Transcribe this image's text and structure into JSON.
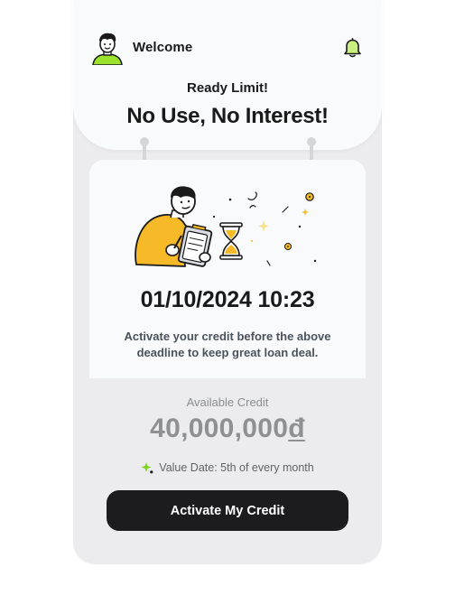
{
  "header": {
    "welcome": "Welcome",
    "subtitle": "Ready Limit!",
    "headline": "No Use, No Interest!"
  },
  "offer": {
    "deadline": "01/10/2024 10:23",
    "description": "Activate your credit before the above deadline to keep great loan deal."
  },
  "credit": {
    "label": "Available Credit",
    "amount": "40,000,000",
    "currency_symbol": "đ",
    "value_date": "Value Date: 5th of every month"
  },
  "cta": {
    "label": "Activate My Credit"
  },
  "icons": {
    "avatar": "user-avatar-icon",
    "bell": "bell-icon",
    "sparkle": "sparkle-icon"
  },
  "colors": {
    "accent_green": "#9be22d",
    "accent_yellow": "#f6b928",
    "button_bg": "#1c1c1e",
    "card_bg": "#f9fafb",
    "page_bg": "#ececee"
  }
}
